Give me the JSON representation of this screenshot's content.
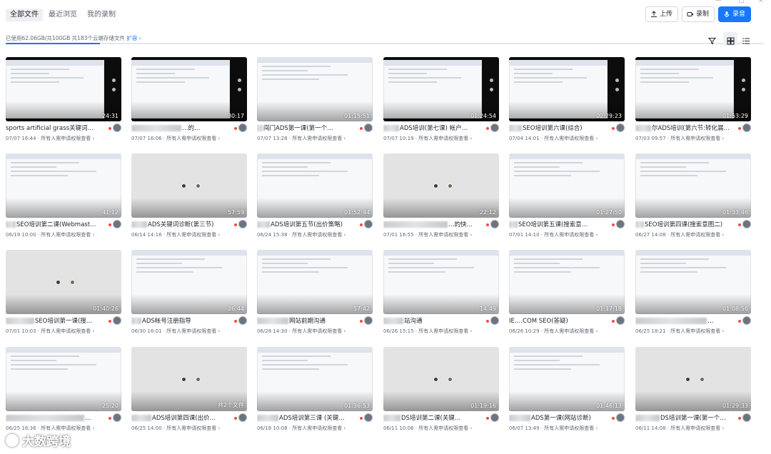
{
  "tabs": [
    "全部文件",
    "最近浏览",
    "我的录制"
  ],
  "window_controls": [
    "—",
    "□",
    "×"
  ],
  "toolbar": {
    "upload_label": "上传",
    "record_label": "录制",
    "audio_label": "录音"
  },
  "storage": {
    "text": "已使用62.06GB/共100GB  共183个云端存储文件",
    "expand_label": "扩容 ›",
    "used_fraction": 0.62
  },
  "colors": {
    "accent": "#1677ff",
    "red_dot": "#f54a45"
  },
  "view_icons": [
    "filter-icon",
    "grid-view-icon",
    "list-view-icon"
  ],
  "items": [
    {
      "title": "sports artificial grass关键词…",
      "blur": 0,
      "meta": "07/07 16:44 · 所有人需申请权限查看 ›",
      "duration": "24:31",
      "thumb": "black",
      "dots": false
    },
    {
      "title": "…的…",
      "blur": 70,
      "meta": "07/07 16:06 · 所有人需申请权限查看 ›",
      "duration": "30:17",
      "thumb": "black",
      "dots": false
    },
    {
      "title": "闯门ADS第一课(第一个…",
      "blur": 8,
      "meta": "07/07 13:28 · 所有人需申请权限查看 ›",
      "duration": "01:15:51",
      "thumb": "light",
      "dots": false
    },
    {
      "title": "ADS培训(第七课) 帐户…",
      "blur": 22,
      "meta": "07/07 10:19 · 所有人需申请权限查看 ›",
      "duration": "01:24:54",
      "thumb": "black",
      "dots": false
    },
    {
      "title": "SEO培训第六课(综合)",
      "blur": 18,
      "meta": "07/04 14:01 · 所有人需申请权限查看 ›",
      "duration": "02:29:23",
      "thumb": "black",
      "dots": false
    },
    {
      "title": "尔ADS培训(第六节:转化漏…",
      "blur": 22,
      "meta": "07/03 09:57 · 所有人需申请权限查看 ›",
      "duration": "01:53:29",
      "thumb": "black",
      "dots": false
    },
    {
      "title": "SEO培训第二课(Webmast…",
      "blur": 14,
      "meta": "06/19 10:00 · 所有人需申请权限查看 ›",
      "duration": "41:12",
      "thumb": "light",
      "dots": false
    },
    {
      "title": "ADS关键词诊断(第三节)",
      "blur": 22,
      "meta": "06/14 14:16 · 所有人需申请权限查看 ›",
      "duration": "57:59",
      "thumb": "gray",
      "dots": true
    },
    {
      "title": "ADS培训第五节(出价策略)",
      "blur": 18,
      "meta": "06/24 15:38 · 所有人需申请权限查看 ›",
      "duration": "01:52:44",
      "thumb": "light",
      "dots": false
    },
    {
      "title": "…的快…",
      "blur": 90,
      "meta": "07/01 16:55 · 所有人需申请权限查看 ›",
      "duration": "22:12",
      "thumb": "gray",
      "dots": true
    },
    {
      "title": "SEO培训第五课(搜索意…",
      "blur": 12,
      "meta": "07/01 14:10 · 所有人需申请权限查看 ›",
      "duration": "01:27:50",
      "thumb": "light",
      "dots": false
    },
    {
      "title": "SEO培训第四课(搜索意图二)",
      "blur": 12,
      "meta": "06/27 14:08 · 所有人需申请权限查看 ›",
      "duration": "01:33:46",
      "thumb": "light",
      "dots": false
    },
    {
      "title": "SEO培训第一课(搜…",
      "blur": 40,
      "meta": "07/01 10:03 · 所有人需申请权限查看 ›",
      "duration": "01:40:26",
      "thumb": "gray",
      "dots": true
    },
    {
      "title": "ADS帐号注册指导",
      "blur": 14,
      "meta": "06/30 16:01 · 所有人需申请权限查看 ›",
      "duration": "26:44",
      "thumb": "light",
      "dots": false
    },
    {
      "title": "网站前期沟通",
      "blur": 44,
      "meta": "06/28 14:30 · 所有人需申请权限查看 ›",
      "duration": "57:42",
      "thumb": "light",
      "dots": false
    },
    {
      "title": "站沟通",
      "blur": 28,
      "meta": "06/26 15:15 · 所有人需申请权限查看 ›",
      "duration": "14:49",
      "thumb": "light",
      "dots": false
    },
    {
      "title": "IE….COM SEO(答疑)",
      "blur": 0,
      "meta": "06/26 10:29 · 所有人需申请权限查看 ›",
      "duration": "01:17:18",
      "thumb": "light",
      "dots": false
    },
    {
      "title": "…",
      "blur": 100,
      "meta": "06/25 18:21 · 所有人需申请权限查看 ›",
      "duration": "01:08:56",
      "thumb": "light",
      "dots": false
    },
    {
      "title": "…",
      "blur": 110,
      "meta": "06/25 16:36 · 所有人需申请权限查看 ›",
      "duration": "25:20",
      "thumb": "light",
      "dots": false
    },
    {
      "title": "ADS培训第四课(出价…",
      "blur": 28,
      "meta": "06/25 14:00 · 所有人需申请权限查看 ›",
      "duration": "共2个文件",
      "thumb": "gray",
      "dots": true
    },
    {
      "title": "ADS培训第三课 (关键…",
      "blur": 30,
      "meta": "06/18 10:08 · 所有人需申请权限查看 ›",
      "duration": "01:36:53",
      "thumb": "light",
      "dots": false
    },
    {
      "title": "DS培训第二课(关键…",
      "blur": 24,
      "meta": "06/11 10:06 · 所有人需申请权限查看 ›",
      "duration": "01:19:16",
      "thumb": "gray",
      "dots": true
    },
    {
      "title": "ADS第一课(网站诊断)",
      "blur": 30,
      "meta": "06/07 13:49 · 所有人需申请权限查看 ›",
      "duration": "01:46:13",
      "thumb": "light",
      "dots": false
    },
    {
      "title": "DS培训第一课(第一个…",
      "blur": 34,
      "meta": "06/11 14:08 · 所有人需申请权限查看 ›",
      "duration": "01:29:33",
      "thumb": "gray",
      "dots": true
    }
  ],
  "watermark": "大数跨境"
}
